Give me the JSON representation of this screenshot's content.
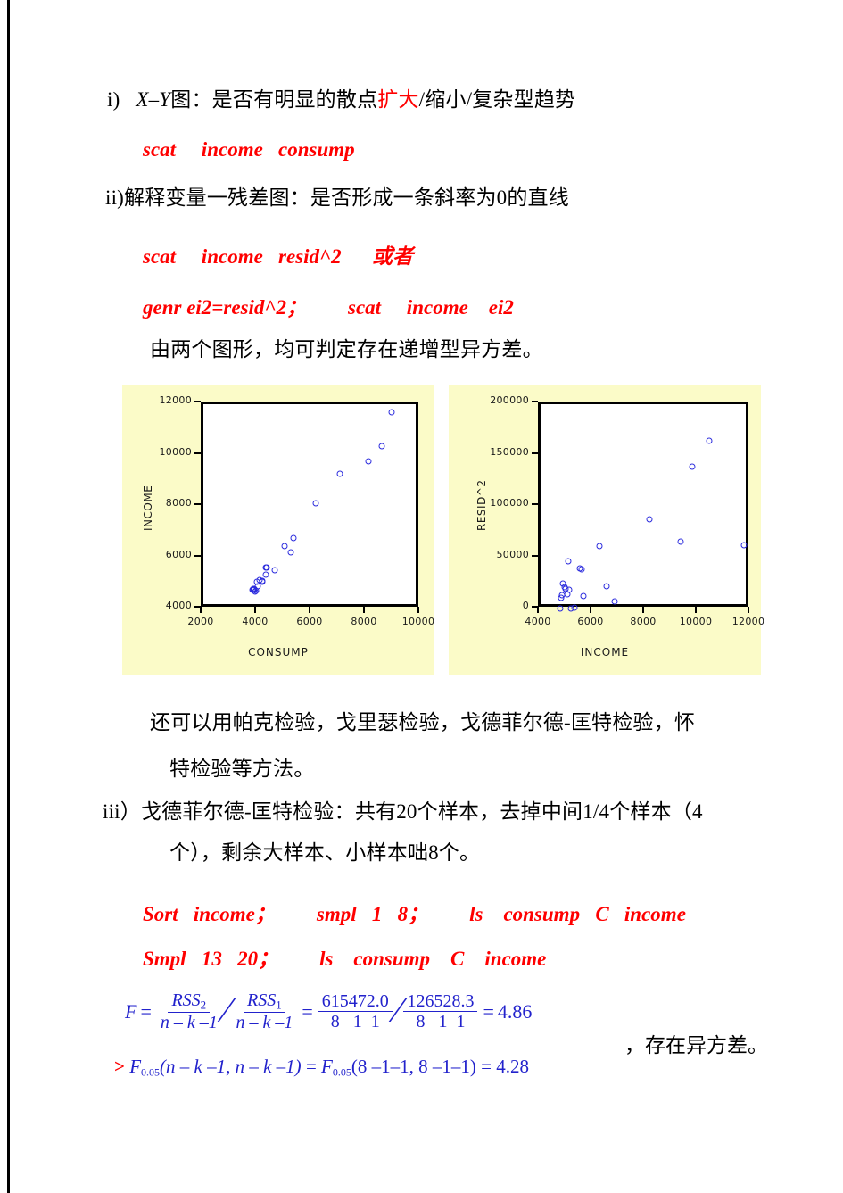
{
  "document": {
    "sections": [
      {
        "marker": "i)",
        "text_parts": [
          {
            "t": "X",
            "style": "math-italic"
          },
          {
            "t": " – ",
            "style": "math"
          },
          {
            "t": "Y",
            "style": "math-italic"
          },
          {
            "t": "图：是否有明显的散点",
            "style": "cn"
          },
          {
            "t": "扩大",
            "style": "red"
          },
          {
            "t": "/缩小/复杂型趋势",
            "style": "cn"
          }
        ]
      }
    ],
    "line_i_marker": "i)",
    "line_i_math_x": "X",
    "line_i_math_dash": "–",
    "line_i_math_y": "Y",
    "line_i_cn_a": "图：是否有明显的散点",
    "line_i_red": "扩大",
    "line_i_cn_b": "/缩小/复杂型趋势",
    "cmd_1": "scat     income   consump",
    "line_ii": "ii)解释变量一残差图：是否形成一条斜率为0的直线",
    "cmd_2": "scat     income   resid^2      或者",
    "cmd_3": "genr ei2=resid^2；        scat     income    ei2",
    "note_charts": "由两个图形，均可判定存在递增型异方差。",
    "after_charts_1": "还可以用帕克检验，戈里瑟检验，戈德菲尔德-匡特检验，怀",
    "after_charts_2": "特检验等方法。",
    "line_iii_a": "iii）戈德菲尔德-匡特检验：共有20个样本，去掉中间1/4个样本（4",
    "line_iii_b": "个），剩余大样本、小样本咄8个。",
    "cmd_4": "Sort   income；        smpl   1   8；        ls    consump   C   income",
    "cmd_5": "Smpl   13   20；        ls    consump    C    income",
    "formula": {
      "F": "F",
      "equals": "=",
      "num1": "RSS",
      "num1_sub": "2",
      "den1": "n – k –1",
      "num2": "RSS",
      "num2_sub": "1",
      "den2": "n – k –1",
      "num3": "615472.0",
      "den3": "8 –1–1",
      "num4": "126528.3",
      "den4": "8 –1–1",
      "result": "4.86",
      "slash": "∕"
    },
    "tail_cn": "，存在异方差。",
    "formula2": {
      "gt": ">",
      "F": "F",
      "sub": "0.05",
      "args1": "(n – k –1, n – k –1)",
      "eq": "=",
      "F2": "F",
      "sub2": "0.05",
      "args2": "(8 –1–1, 8 –1–1)",
      "eq2": "=",
      "result2": "4.28"
    }
  },
  "colors": {
    "chart_background": "#fbfbc8",
    "plot_background": "#ffffff",
    "marker": "#2b2bdd",
    "axis": "#000000",
    "command_text": "#ff0000",
    "formula_text": "#2222cc"
  },
  "chart_data": [
    {
      "type": "scatter",
      "title": "",
      "xlabel": "CONSUMP",
      "ylabel": "INCOME",
      "xlim": [
        2000,
        10000
      ],
      "ylim": [
        4000,
        12000
      ],
      "xticks": [
        2000,
        4000,
        6000,
        8000,
        10000
      ],
      "yticks": [
        4000,
        6000,
        8000,
        10000,
        12000
      ],
      "grid": false,
      "legend": "none",
      "points": [
        {
          "x": 3790,
          "y": 4780
        },
        {
          "x": 3820,
          "y": 4790
        },
        {
          "x": 3840,
          "y": 4760
        },
        {
          "x": 3860,
          "y": 4770
        },
        {
          "x": 3880,
          "y": 4800
        },
        {
          "x": 3900,
          "y": 4700
        },
        {
          "x": 3920,
          "y": 4740
        },
        {
          "x": 3960,
          "y": 5090
        },
        {
          "x": 4010,
          "y": 4900
        },
        {
          "x": 4060,
          "y": 5140
        },
        {
          "x": 4150,
          "y": 5090
        },
        {
          "x": 4180,
          "y": 5110
        },
        {
          "x": 4290,
          "y": 5350
        },
        {
          "x": 4300,
          "y": 5620
        },
        {
          "x": 4330,
          "y": 5630
        },
        {
          "x": 4620,
          "y": 5520
        },
        {
          "x": 4990,
          "y": 6470
        },
        {
          "x": 5210,
          "y": 6220
        },
        {
          "x": 5320,
          "y": 6790
        },
        {
          "x": 6120,
          "y": 8130
        },
        {
          "x": 7030,
          "y": 9270
        },
        {
          "x": 8050,
          "y": 9760
        },
        {
          "x": 8550,
          "y": 10360
        },
        {
          "x": 8930,
          "y": 11680
        }
      ]
    },
    {
      "type": "scatter",
      "title": "",
      "xlabel": "INCOME",
      "ylabel": "RESID^2",
      "xlim": [
        4000,
        12000
      ],
      "ylim": [
        0,
        200000
      ],
      "xticks": [
        4000,
        6000,
        8000,
        10000,
        12000
      ],
      "yticks": [
        0,
        50000,
        100000,
        150000,
        200000
      ],
      "grid": false,
      "legend": "none",
      "points": [
        {
          "x": 4750,
          "y": 1000
        },
        {
          "x": 4780,
          "y": 11000
        },
        {
          "x": 4800,
          "y": 14000
        },
        {
          "x": 4850,
          "y": 25000
        },
        {
          "x": 4900,
          "y": 22000
        },
        {
          "x": 4950,
          "y": 20000
        },
        {
          "x": 5000,
          "y": 15000
        },
        {
          "x": 5050,
          "y": 47000
        },
        {
          "x": 5100,
          "y": 19000
        },
        {
          "x": 5150,
          "y": 1000
        },
        {
          "x": 5300,
          "y": 1500
        },
        {
          "x": 5480,
          "y": 40000
        },
        {
          "x": 5560,
          "y": 39000
        },
        {
          "x": 5640,
          "y": 13000
        },
        {
          "x": 6230,
          "y": 62000
        },
        {
          "x": 6520,
          "y": 23000
        },
        {
          "x": 6830,
          "y": 8000
        },
        {
          "x": 8140,
          "y": 88000
        },
        {
          "x": 9320,
          "y": 66000
        },
        {
          "x": 9770,
          "y": 139000
        },
        {
          "x": 10420,
          "y": 164000
        },
        {
          "x": 11730,
          "y": 63000
        }
      ]
    }
  ]
}
